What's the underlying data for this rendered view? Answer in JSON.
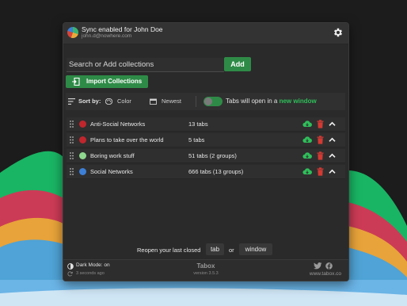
{
  "header": {
    "sync_title": "Sync enabled for John Doe",
    "email": "john.d@nowhere.com",
    "settings_icon": "gear-icon"
  },
  "search": {
    "placeholder": "Search or Add collections",
    "value": ""
  },
  "add_label": "Add",
  "import_label": "Import Collections",
  "sort": {
    "label": "Sort by:",
    "options": [
      "Color",
      "Newest"
    ]
  },
  "toggle": {
    "enabled": true,
    "text": "Tabs will open in a ",
    "highlight": "new window"
  },
  "collections": [
    {
      "name": "Anti-Social Networks",
      "count": "13 tabs",
      "color": "#c0262d"
    },
    {
      "name": "Plans to take over the world",
      "count": "5 tabs",
      "color": "#c0262d"
    },
    {
      "name": "Boring work stuff",
      "count": "51 tabs (2 groups)",
      "color": "#8fd68f"
    },
    {
      "name": "Social Networks",
      "count": "666 tabs (13 groups)",
      "color": "#3d7fd6"
    }
  ],
  "reopen": {
    "text": "Reopen your last closed",
    "tab_label": "tab",
    "or": "or",
    "window_label": "window"
  },
  "footer": {
    "dark_mode": "Dark Mode: on",
    "sync_time": "3 seconds ago",
    "brand": "Tabox",
    "version": "version 3.5.3",
    "website": "www.tabox.co"
  },
  "colors": {
    "accent": "#2e8b47",
    "highlight_text": "#2fbf5a",
    "cloud": "#2fbf5a",
    "trash": "#d23a33"
  }
}
